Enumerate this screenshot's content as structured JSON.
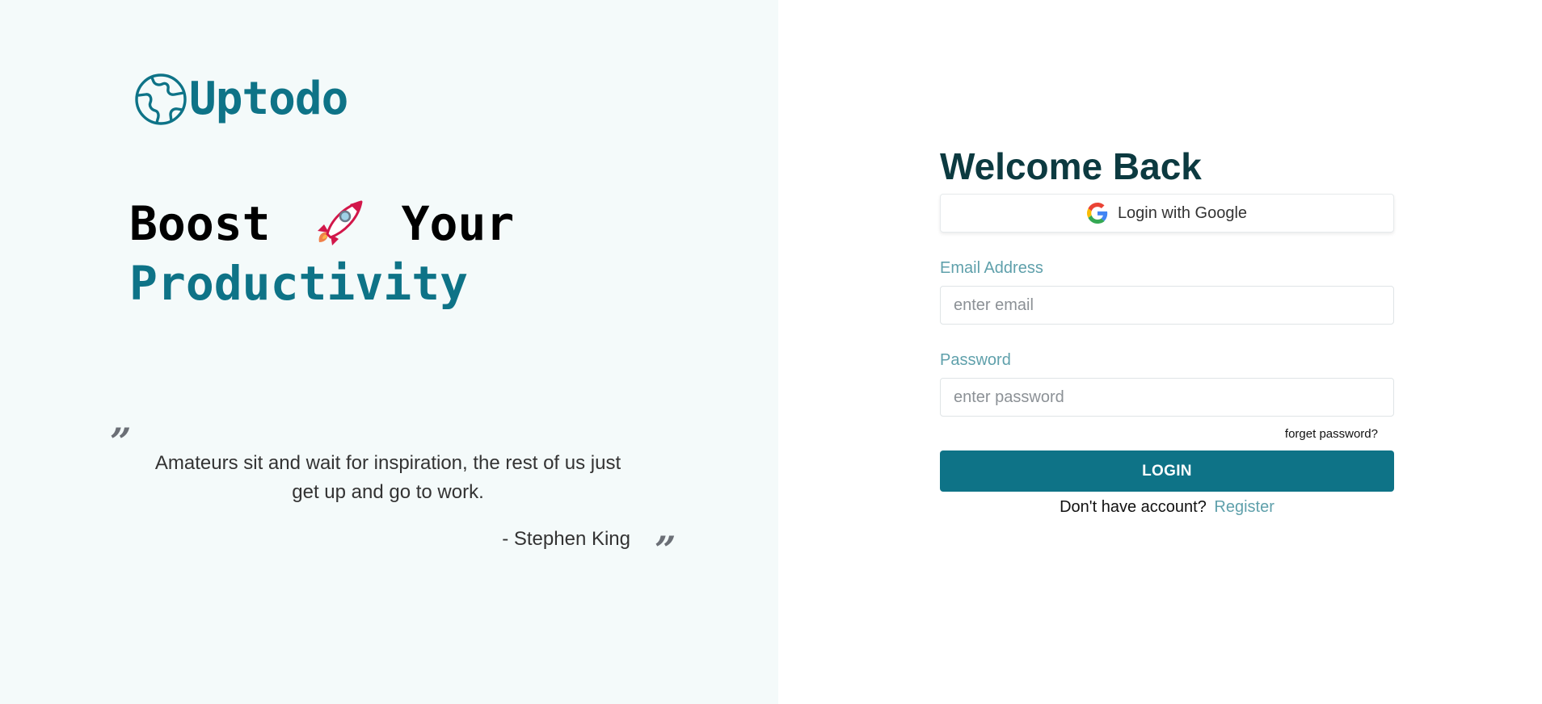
{
  "brand": {
    "name": "Uptodo",
    "icon": "globe-icon"
  },
  "hero": {
    "line1_word1": "Boost",
    "line1_icon": "rocket-icon",
    "line1_word2": "Your",
    "line2": "Productivity"
  },
  "quote": {
    "text": "Amateurs sit and wait for inspiration, the rest of us just get up and go to work.",
    "author": "- Stephen King",
    "open_mark": "”",
    "close_mark": "”"
  },
  "login": {
    "title": "Welcome Back",
    "google_label": "Login with Google",
    "email_label": "Email Address",
    "email_placeholder": "enter email",
    "email_value": "",
    "password_label": "Password",
    "password_placeholder": "enter password",
    "password_value": "",
    "forget_label": "forget password?",
    "submit_label": "LOGIN",
    "register_prompt": "Don't have account?",
    "register_label": "Register"
  },
  "colors": {
    "brand": "#0e7387",
    "left_bg": "#f4fafa",
    "label": "#5fa0ab",
    "title": "#0c3a40"
  }
}
